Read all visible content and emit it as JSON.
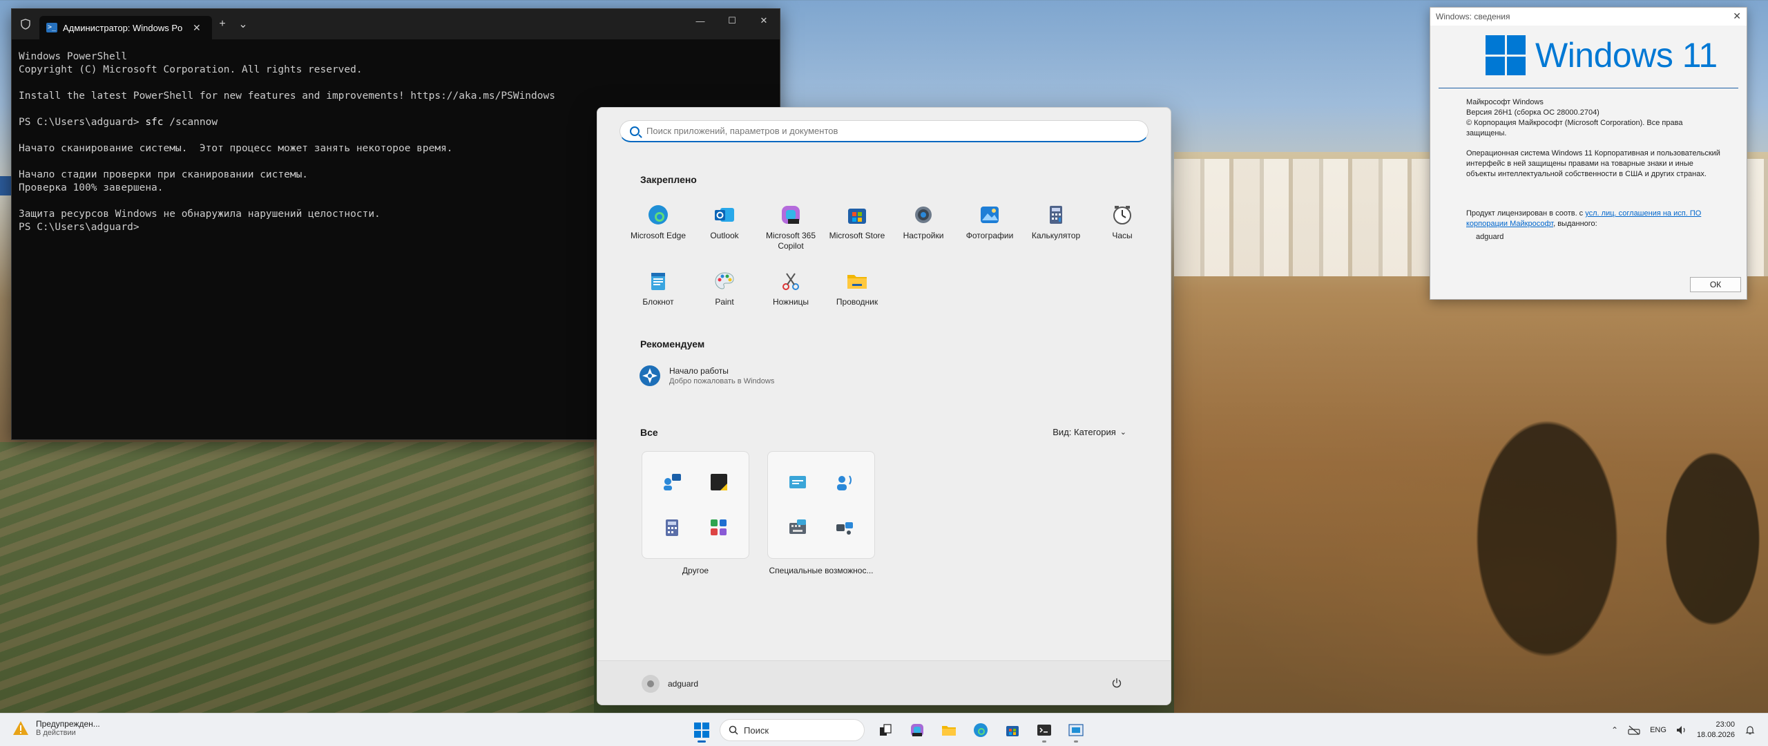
{
  "terminal": {
    "tab_title": "Администратор: Windows Po",
    "lines": [
      {
        "text": "Windows PowerShell"
      },
      {
        "text": "Copyright (C) Microsoft Corporation. All rights reserved."
      },
      {
        "text": ""
      },
      {
        "text": "Install the latest PowerShell for new features and improvements! https://aka.ms/PSWindows"
      },
      {
        "text": ""
      },
      {
        "prompt": "PS C:\\Users\\adguard> ",
        "cmd": "sfc",
        "arg": " /scannow"
      },
      {
        "text": ""
      },
      {
        "text": "Начато сканирование системы.  Этот процесс может занять некоторое время."
      },
      {
        "text": ""
      },
      {
        "text": "Начало стадии проверки при сканировании системы."
      },
      {
        "text": "Проверка 100% завершена."
      },
      {
        "text": ""
      },
      {
        "text": "Защита ресурсов Windows не обнаружила нарушений целостности."
      },
      {
        "prompt": "PS C:\\Users\\adguard> "
      }
    ]
  },
  "start_menu": {
    "search_placeholder": "Поиск приложений, параметров и документов",
    "pinned_title": "Закреплено",
    "pinned": [
      {
        "label": "Microsoft Edge",
        "icon": "edge-icon"
      },
      {
        "label": "Outlook",
        "icon": "outlook-icon"
      },
      {
        "label": "Microsoft 365 Copilot",
        "icon": "m365-copilot-icon"
      },
      {
        "label": "Microsoft Store",
        "icon": "store-icon"
      },
      {
        "label": "Настройки",
        "icon": "settings-icon"
      },
      {
        "label": "Фотографии",
        "icon": "photos-icon"
      },
      {
        "label": "Калькулятор",
        "icon": "calculator-icon"
      },
      {
        "label": "Часы",
        "icon": "clock-icon"
      },
      {
        "label": "Блокнот",
        "icon": "notepad-icon"
      },
      {
        "label": "Paint",
        "icon": "paint-icon"
      },
      {
        "label": "Ножницы",
        "icon": "snipping-tool-icon"
      },
      {
        "label": "Проводник",
        "icon": "file-explorer-icon"
      }
    ],
    "recommended_title": "Рекомендуем",
    "recommended": [
      {
        "title": "Начало работы",
        "subtitle": "Добро пожаловать в Windows"
      }
    ],
    "all_title": "Все",
    "view_label": "Вид: Категория",
    "folders": [
      {
        "label": "Другое"
      },
      {
        "label": "Специальные возможнос..."
      }
    ],
    "user_name": "adguard"
  },
  "about_dialog": {
    "title": "Windows: сведения",
    "product": "Windows 11",
    "lines": [
      "Майкрософт Windows",
      "Версия 26H1 (сборка ОС 28000.2704)",
      "© Корпорация Майкрософт (Microsoft Corporation). Все права защищены.",
      "Операционная система Windows 11 Корпоративная и пользовательский интерфейс в ней защищены правами на товарные знаки и иные объекты интеллектуальной собственности в США и других странах."
    ],
    "license_prefix": "Продукт лицензирован в соотв. с ",
    "license_link": "усл. лиц. соглашения на исп. ПО корпорации Майкрософт",
    "license_suffix": ", выданного:",
    "licensee": "adguard",
    "ok_label": "ОК"
  },
  "taskbar": {
    "notification_title": "Предупрежден...",
    "notification_sub": "В действии",
    "search_label": "Поиск",
    "language": "ENG",
    "time": "23:00",
    "date": "18.08.2026"
  },
  "colors": {
    "accent": "#0067c0",
    "windows_blue": "#0078d4",
    "terminal_bg": "#0c0c0c"
  }
}
